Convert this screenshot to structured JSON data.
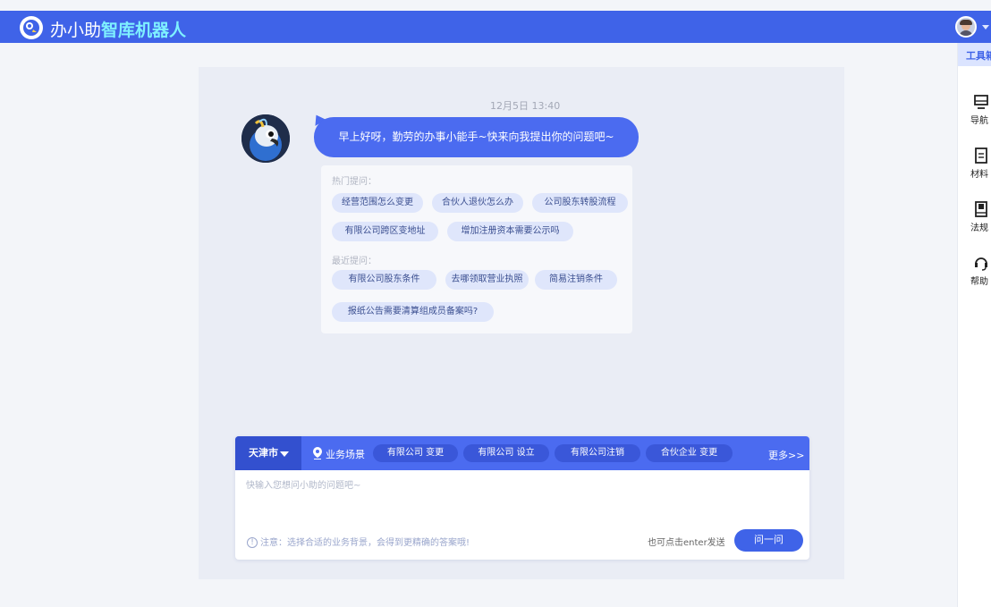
{
  "header": {
    "brand_prefix": "办小助",
    "brand_accent": "智库机器人"
  },
  "toolbox": {
    "title": "工具箱",
    "items": [
      {
        "label": "导航",
        "icon": "monitor-icon"
      },
      {
        "label": "材料",
        "icon": "document-icon"
      },
      {
        "label": "法规",
        "icon": "book-icon"
      },
      {
        "label": "帮助",
        "icon": "headset-icon"
      }
    ]
  },
  "chat": {
    "timestamp": "12月5日 13:40",
    "greeting": "早上好呀，勤劳的办事小能手~快来向我提出你的问题吧~",
    "hot_title": "热门提问：",
    "hot_questions": [
      "经营范围怎么变更",
      "合伙人退伙怎么办",
      "公司股东转股流程",
      "有限公司跨区变地址",
      "增加注册资本需要公示吗"
    ],
    "recent_title": "最近提问：",
    "recent_questions": [
      "有限公司股东条件",
      "去哪领取营业执照",
      "简易注销条件",
      "报纸公告需要清算组成员备案吗?"
    ]
  },
  "input_panel": {
    "city": "天津市",
    "scene_label": "业务场景",
    "scenes": [
      "有限公司 变更",
      "有限公司 设立",
      "有限公司注销",
      "合伙企业 变更"
    ],
    "more_label": "更多>>",
    "placeholder": "快输入您想问小助的问题吧~",
    "notice": "注意：选择合适的业务背景，会得到更精确的答案哦!",
    "enter_hint": "也可点击enter发送",
    "ask_button": "问一问"
  },
  "colors": {
    "primary": "#3f63e8",
    "bubble": "#4b6bf0",
    "chip_bg": "#dfe6fb",
    "panel_bg": "#eaedf5"
  }
}
